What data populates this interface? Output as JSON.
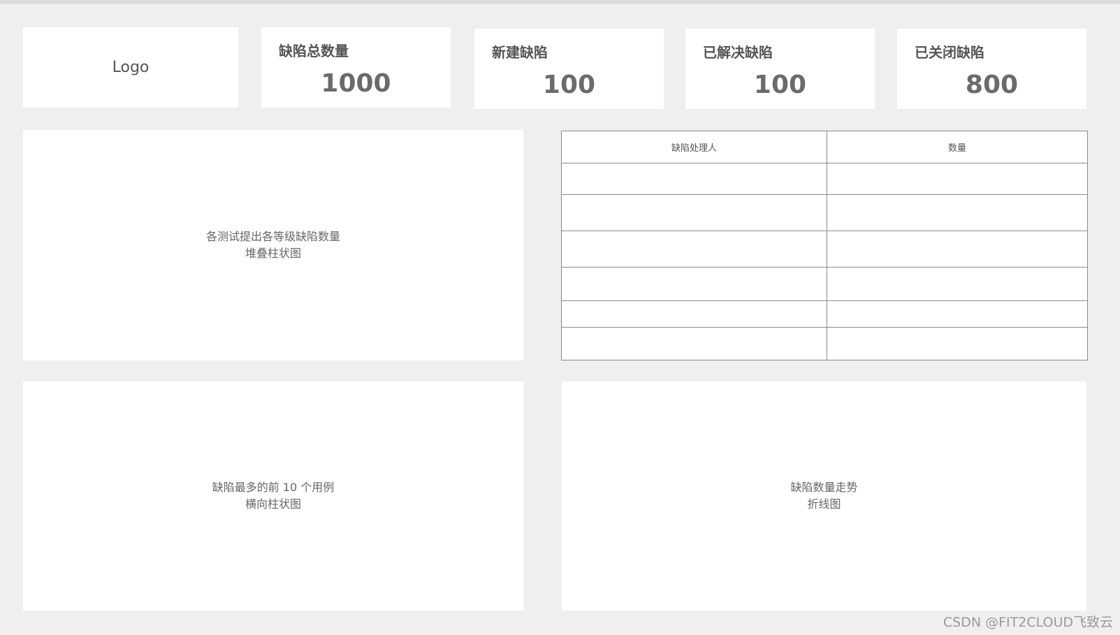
{
  "logo": {
    "text": "Logo"
  },
  "stats": [
    {
      "label": "缺陷总数量",
      "value": "1000"
    },
    {
      "label": "新建缺陷",
      "value": "100"
    },
    {
      "label": "已解决缺陷",
      "value": "100"
    },
    {
      "label": "已关闭缺陷",
      "value": "800"
    }
  ],
  "panels": {
    "stacked_chart": {
      "line1": "各测试提出各等级缺陷数量",
      "line2": "堆叠柱状图"
    },
    "horizontal_chart": {
      "line1": "缺陷最多的前 10 个用例",
      "line2": "横向柱状图"
    },
    "line_chart": {
      "line1": "缺陷数量走势",
      "line2": "折线图"
    }
  },
  "table": {
    "headers": [
      "缺陷处理人",
      "数量"
    ],
    "rows": [
      [
        "",
        ""
      ],
      [
        "",
        ""
      ],
      [
        "",
        ""
      ],
      [
        "",
        ""
      ],
      [
        "",
        ""
      ],
      [
        "",
        ""
      ]
    ]
  },
  "watermark": "CSDN @FIT2CLOUD飞致云"
}
